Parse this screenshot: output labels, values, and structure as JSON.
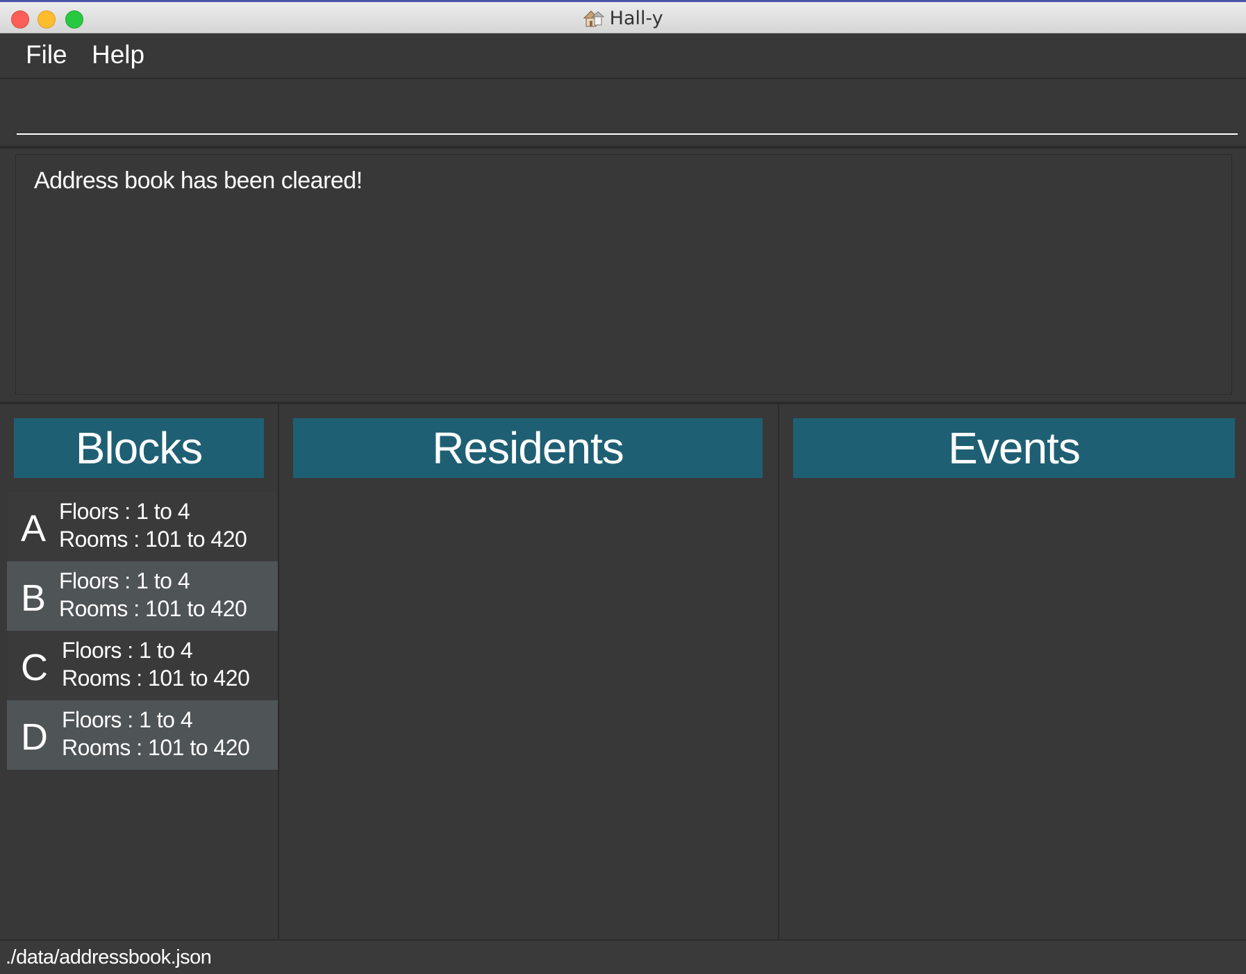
{
  "window": {
    "title": "Hall-y"
  },
  "menu": {
    "file": "File",
    "help": "Help"
  },
  "command": {
    "value": ""
  },
  "result": {
    "message": "Address book has been cleared!"
  },
  "panels": {
    "blocks": {
      "header": "Blocks"
    },
    "residents": {
      "header": "Residents"
    },
    "events": {
      "header": "Events"
    }
  },
  "blocks": [
    {
      "letter": "A",
      "floors": "Floors : 1 to 4",
      "rooms": "Rooms : 101 to 420"
    },
    {
      "letter": "B",
      "floors": "Floors : 1 to 4",
      "rooms": "Rooms : 101 to 420"
    },
    {
      "letter": "C",
      "floors": "Floors : 1 to 4",
      "rooms": "Rooms : 101 to 420"
    },
    {
      "letter": "D",
      "floors": "Floors : 1 to 4",
      "rooms": "Rooms : 101 to 420"
    }
  ],
  "status": {
    "path": "./data/addressbook.json"
  },
  "colors": {
    "header_bg": "#1f5f74",
    "panel_bg": "#383838",
    "alt_row": "#4f5456"
  },
  "icons": {
    "title": "house-icon"
  }
}
